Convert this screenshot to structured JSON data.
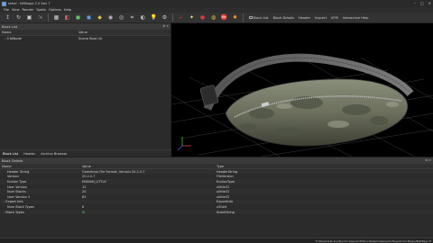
{
  "window": {
    "title": "skfsrf - NifSkope 2.0 Dev 7"
  },
  "menu": [
    "File",
    "View",
    "Render",
    "Spells",
    "Options",
    "Help"
  ],
  "toolbar": {
    "block_list_label": "Block List",
    "block_details_label": "Block Details",
    "header_label": "Header",
    "inspect_label": "Inspect",
    "kfm_label": "KFM",
    "interactive_help_label": "Interactive Help",
    "accent": "#d83b3b"
  },
  "block_list": {
    "title": "Block List",
    "columns": {
      "name": "Name",
      "value": "Value"
    },
    "rows": [
      {
        "name": "0 NiNode",
        "value": "Scene Root (0)"
      }
    ],
    "tabs": [
      "Block List",
      "Header",
      "Archive Browser"
    ]
  },
  "block_details": {
    "title": "Block Details",
    "columns": {
      "name": "Name",
      "value": "Value",
      "type": "Type"
    },
    "rows": [
      {
        "name": "Header String",
        "value": "Gamebryo File Format, Version 20.2.0.7",
        "type": "HeaderString"
      },
      {
        "name": "Version",
        "value": "20.2.0.7",
        "type": "FileVersion"
      },
      {
        "name": "Endian Type",
        "value": "ENDIAN_LITTLE",
        "type": "EndianType"
      },
      {
        "name": "User Version",
        "value": "12",
        "type": "ulittle32"
      },
      {
        "name": "Num Blocks",
        "value": "20",
        "type": "ulittle32"
      },
      {
        "name": "User Version 2",
        "value": "83",
        "type": "ulittle32"
      },
      {
        "name": "Export Info",
        "value": "",
        "type": "ExportInfo",
        "expandable": true
      },
      {
        "name": "Num Block Types",
        "value": "6",
        "type": "uShort"
      },
      {
        "name": "Block Types",
        "value": "",
        "type": "SizedString",
        "expandable": true,
        "icon": "gear"
      }
    ]
  },
  "status": {
    "path": "F:/Steam/Library/Skyrim Special Edition/Data/meshes/clothes/ArmorMagic/BeltBag.nif"
  }
}
